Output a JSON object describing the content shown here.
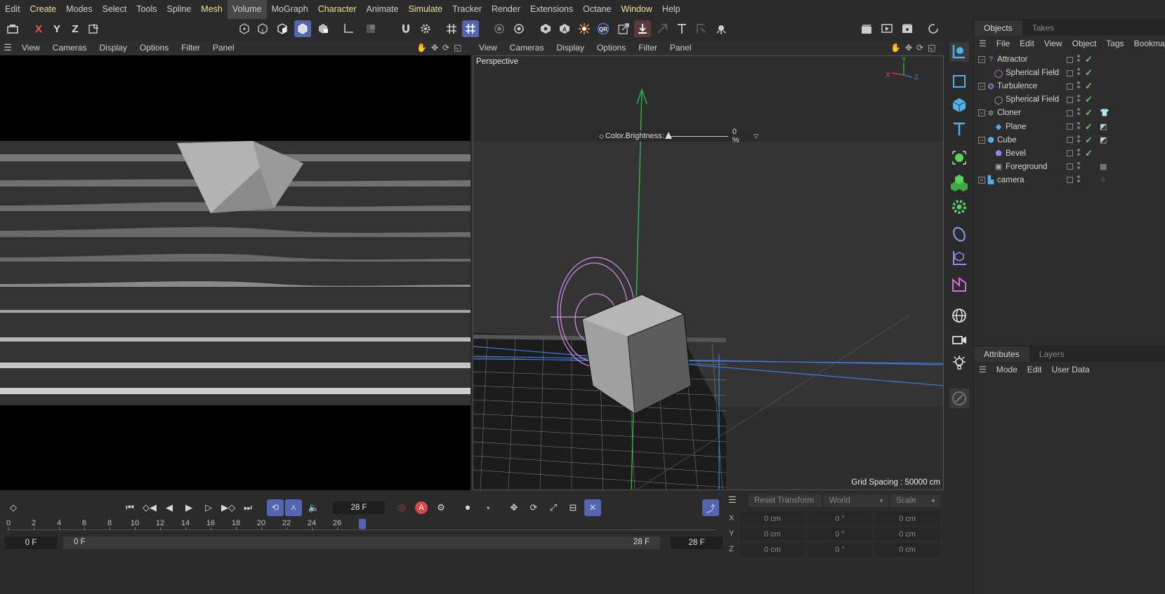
{
  "menubar": {
    "items": [
      {
        "label": "Edit",
        "style": "normal"
      },
      {
        "label": "Create",
        "style": "yellow"
      },
      {
        "label": "Modes",
        "style": "normal"
      },
      {
        "label": "Select",
        "style": "normal"
      },
      {
        "label": "Tools",
        "style": "normal"
      },
      {
        "label": "Spline",
        "style": "normal"
      },
      {
        "label": "Mesh",
        "style": "yellow"
      },
      {
        "label": "Volume",
        "style": "active"
      },
      {
        "label": "MoGraph",
        "style": "normal"
      },
      {
        "label": "Character",
        "style": "yellow"
      },
      {
        "label": "Animate",
        "style": "normal"
      },
      {
        "label": "Simulate",
        "style": "yellow"
      },
      {
        "label": "Tracker",
        "style": "normal"
      },
      {
        "label": "Render",
        "style": "normal"
      },
      {
        "label": "Extensions",
        "style": "normal"
      },
      {
        "label": "Octane",
        "style": "normal"
      },
      {
        "label": "Window",
        "style": "yellow"
      },
      {
        "label": "Help",
        "style": "normal"
      }
    ]
  },
  "toolbar": {
    "axis_x": "X",
    "axis_y": "Y",
    "axis_z": "Z",
    "tools": [
      "undo-view-icon",
      "world-axis-icon",
      "points-mode-icon",
      "edges-mode-icon",
      "polygons-mode-icon",
      "model-mode-icon",
      "texture-mode-icon",
      "axis-mode-icon",
      "solo-icon",
      "magnet-icon",
      "gear-icon",
      "grid-snap-icon",
      "workplane-icon",
      "record-icon",
      "target-icon",
      "octane-icon",
      "text-a-icon",
      "burst-icon",
      "qr-icon",
      "transform-icon",
      "drop-icon",
      "arrow-icon",
      "text-t-icon",
      "corner-icon",
      "bug-icon",
      "clapper-icon",
      "render-view-icon",
      "render-queue-icon",
      "refresh-icon"
    ]
  },
  "viewport_left": {
    "menu": [
      "View",
      "Cameras",
      "Display",
      "Options",
      "Filter",
      "Panel"
    ]
  },
  "viewport_right": {
    "menu": [
      "View",
      "Cameras",
      "Display",
      "Options",
      "Filter",
      "Panel"
    ],
    "camera_label": "Perspective",
    "hud_label": "Color.Brightness:",
    "hud_value": "0 %",
    "hud_fraction": 0.0,
    "grid_spacing": "Grid Spacing : 50000 cm",
    "axis_labels": {
      "x": "X",
      "y": "Y",
      "z": "Z"
    }
  },
  "objects_panel": {
    "tabs": [
      "Objects",
      "Takes"
    ],
    "menu": [
      "File",
      "Edit",
      "View",
      "Object",
      "Tags",
      "Bookmarks"
    ],
    "rows": [
      {
        "name": "Attractor",
        "icon": "attractor-icon",
        "indent": 0,
        "expander": "−",
        "check": "✓",
        "tag": ""
      },
      {
        "name": "Spherical Field",
        "icon": "spherical-field-icon",
        "indent": 1,
        "expander": "",
        "check": "✓",
        "tag": ""
      },
      {
        "name": "Turbulence",
        "icon": "turbulence-icon",
        "indent": 0,
        "expander": "−",
        "check": "✓",
        "tag": ""
      },
      {
        "name": "Spherical Field",
        "icon": "spherical-field-icon",
        "indent": 1,
        "expander": "",
        "check": "✓",
        "tag": ""
      },
      {
        "name": "Cloner",
        "icon": "cloner-icon",
        "indent": 0,
        "expander": "−",
        "check": "✓",
        "tag": "shirt-tag-icon"
      },
      {
        "name": "Plane",
        "icon": "plane-icon",
        "indent": 1,
        "expander": "",
        "check": "✓",
        "tag": "uvw-tag-icon"
      },
      {
        "name": "Cube",
        "icon": "cube-icon",
        "indent": 0,
        "expander": "−",
        "check": "✓",
        "tag": "uvw-tag-icon"
      },
      {
        "name": "Bevel",
        "icon": "bevel-icon",
        "indent": 1,
        "expander": "",
        "check": "✓",
        "tag": ""
      },
      {
        "name": "Foreground",
        "icon": "foreground-icon",
        "indent": 1,
        "expander": "",
        "check": "",
        "tag": "material-tag-icon"
      },
      {
        "name": "camera",
        "icon": "camera-icon",
        "indent": 0,
        "expander": "+",
        "check": "",
        "tag": "target-tag-icon"
      }
    ]
  },
  "attributes_panel": {
    "tabs": [
      "Attributes",
      "Layers"
    ],
    "menu": [
      "Mode",
      "Edit",
      "User Data"
    ]
  },
  "timeline": {
    "current_frame": "28 F",
    "start_frame": "0 F",
    "range_start": "0 F",
    "range_end": "28 F",
    "end_frame": "28 F",
    "ruler_ticks": [
      "0",
      "2",
      "4",
      "6",
      "8",
      "10",
      "12",
      "14",
      "16",
      "18",
      "20",
      "22",
      "24",
      "26",
      "2"
    ],
    "playhead_frame": 28
  },
  "coordinates": {
    "reset_label": "Reset Transform",
    "space_label": "World",
    "mode_label": "Scale",
    "rows": [
      {
        "axis": "X",
        "pos": "0 cm",
        "rot": "0 °",
        "scale": "0 cm"
      },
      {
        "axis": "Y",
        "pos": "0 cm",
        "rot": "0 °",
        "scale": "0 cm"
      },
      {
        "axis": "Z",
        "pos": "0 cm",
        "rot": "0 °",
        "scale": "0 cm"
      }
    ]
  },
  "colors": {
    "accent": "#5564b0",
    "check_green": "#5ad35a",
    "menu_yellow": "#f2e394",
    "y_axis_green": "#2ec24a",
    "field_pink": "#d88cf0",
    "guide_blue": "#3d7de0"
  }
}
